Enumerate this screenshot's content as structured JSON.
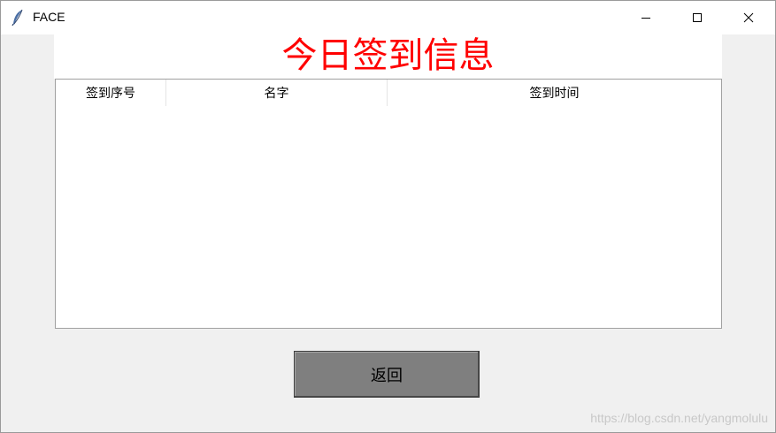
{
  "window": {
    "title": "FACE",
    "icon": "feather-icon",
    "controls": [
      "minimize-icon",
      "maximize-icon",
      "close-icon"
    ]
  },
  "page": {
    "title": "今日签到信息",
    "title_color": "#ff0000"
  },
  "table": {
    "columns": [
      "签到序号",
      "名字",
      "签到时间"
    ],
    "rows": []
  },
  "actions": {
    "return_label": "返回"
  },
  "watermark": "https://blog.csdn.net/yangmolulu"
}
